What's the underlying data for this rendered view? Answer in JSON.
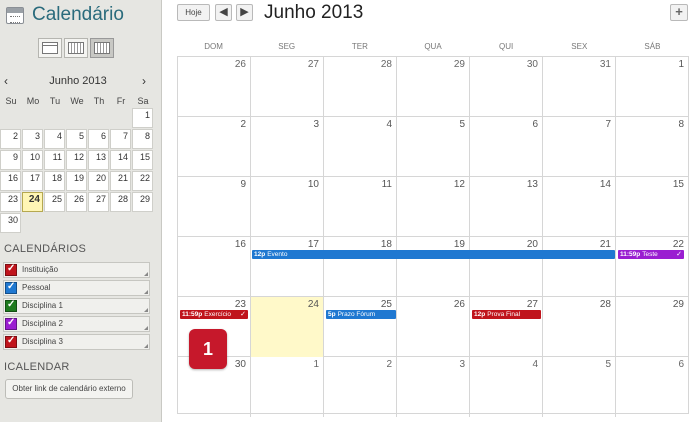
{
  "sidebar": {
    "title": "Calendário",
    "views": [
      "day-view",
      "week-view",
      "month-view"
    ],
    "mini_calendar": {
      "month_label": "Junho 2013",
      "prev": "‹",
      "next": "›",
      "weekdays": [
        "Su",
        "Mo",
        "Tu",
        "We",
        "Th",
        "Fr",
        "Sa"
      ],
      "rows": [
        [
          "",
          "",
          "",
          "",
          "",
          "",
          "1"
        ],
        [
          "2",
          "3",
          "4",
          "5",
          "6",
          "7",
          "8"
        ],
        [
          "9",
          "10",
          "11",
          "12",
          "13",
          "14",
          "15"
        ],
        [
          "16",
          "17",
          "18",
          "19",
          "20",
          "21",
          "22"
        ],
        [
          "23",
          "24",
          "25",
          "26",
          "27",
          "28",
          "29"
        ],
        [
          "30",
          "",
          "",
          "",
          "",
          "",
          ""
        ]
      ],
      "today": "24"
    },
    "calendars_title": "CALENDÁRIOS",
    "calendars": [
      {
        "name": "Instituição",
        "color": "#c0141c"
      },
      {
        "name": "Pessoal",
        "color": "#1f78d1"
      },
      {
        "name": "Disciplina 1",
        "color": "#1e7a1e"
      },
      {
        "name": "Disciplina 2",
        "color": "#9a1ed1"
      },
      {
        "name": "Disciplina 3",
        "color": "#c0141c"
      }
    ],
    "icalendar_title": "ICALENDAR",
    "external_link_button": "Obter link de calendário externo"
  },
  "toolbar": {
    "today_label": "Hoje",
    "prev_label": "◀",
    "next_label": "▶",
    "add_label": "+",
    "month_title": "Junho 2013"
  },
  "weekdays": [
    "DOM",
    "SEG",
    "TER",
    "QUA",
    "QUI",
    "SEX",
    "SÁB"
  ],
  "weeks": [
    [
      "26",
      "27",
      "28",
      "29",
      "30",
      "31",
      "1"
    ],
    [
      "2",
      "3",
      "4",
      "5",
      "6",
      "7",
      "8"
    ],
    [
      "9",
      "10",
      "11",
      "12",
      "13",
      "14",
      "15"
    ],
    [
      "16",
      "17",
      "18",
      "19",
      "20",
      "21",
      "22"
    ],
    [
      "23",
      "24",
      "25",
      "26",
      "27",
      "28",
      "29"
    ],
    [
      "30",
      "1",
      "2",
      "3",
      "4",
      "5",
      "6"
    ]
  ],
  "events": [
    {
      "time": "12p",
      "title": "Evento",
      "color": "#1f78d1",
      "check": false
    },
    {
      "time": "11:59p",
      "title": "Teste",
      "color": "#9a1ed1",
      "check": true
    },
    {
      "time": "11:59p",
      "title": "Exercício",
      "color": "#c0141c",
      "check": true
    },
    {
      "time": "5p",
      "title": "Prazo Fórum",
      "color": "#1f78d1",
      "check": false
    },
    {
      "time": "12p",
      "title": "Prova Final",
      "color": "#c0141c",
      "check": false
    }
  ],
  "callout_badge": "1"
}
